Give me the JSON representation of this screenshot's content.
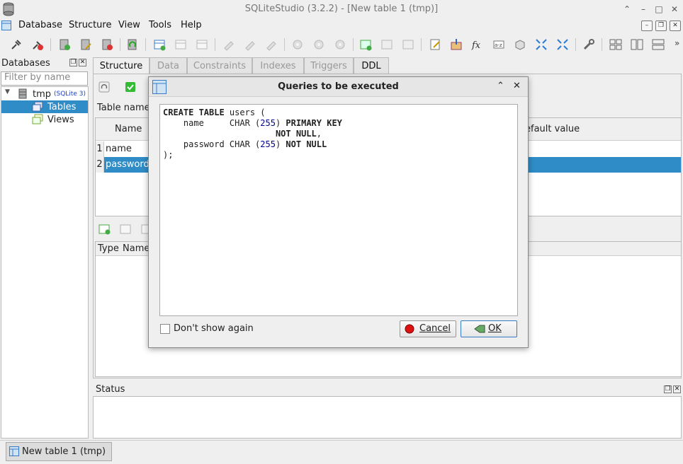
{
  "window": {
    "title": "SQLiteStudio (3.2.2) - [New table 1 (tmp)]"
  },
  "menu": [
    "Database",
    "Structure",
    "View",
    "Tools",
    "Help"
  ],
  "databases_panel": {
    "title": "Databases",
    "filter_placeholder": "Filter by name",
    "db_name": "tmp",
    "db_type": "(SQLite 3)",
    "items": [
      "Tables",
      "Views"
    ]
  },
  "tabs": [
    "Structure",
    "Data",
    "Constraints",
    "Indexes",
    "Triggers",
    "DDL"
  ],
  "editor": {
    "table_name_label": "Table name:",
    "columns_header": {
      "name": "Name",
      "default": "efault value"
    },
    "rows": [
      {
        "num": "1",
        "name": "name"
      },
      {
        "num": "2",
        "name": "password"
      }
    ],
    "constraints_header": {
      "type": "Type",
      "name": "Name"
    }
  },
  "status": {
    "title": "Status"
  },
  "taskbar": {
    "item": "New table 1 (tmp)"
  },
  "dialog": {
    "title": "Queries to be executed",
    "dont_show_label": "Don't show again",
    "cancel_label": "Cancel",
    "ok_label": "OK"
  }
}
